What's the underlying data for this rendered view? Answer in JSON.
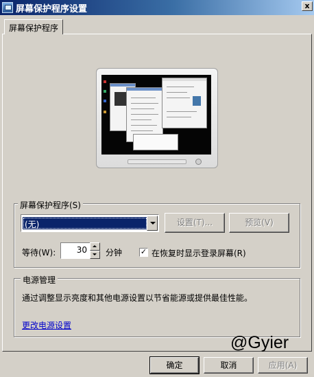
{
  "window": {
    "title": "屏幕保护程序设置",
    "close_glyph": "x"
  },
  "tabs": [
    {
      "label": "屏幕保护程序",
      "selected": true
    }
  ],
  "screensaver": {
    "group_label": "屏幕保护程序(S)",
    "selected_value": "(无)",
    "settings_label": "设置(T)...",
    "preview_label": "预览(V)",
    "wait_label": "等待(W):",
    "wait_value": "30",
    "wait_unit": "分钟",
    "resume_checkbox_label": "在恢复时显示登录屏幕(R)",
    "resume_checked": true,
    "check_glyph": "✓"
  },
  "power": {
    "group_label": "电源管理",
    "description": "通过调整显示亮度和其他电源设置以节省能源或提供最佳性能。",
    "link": "更改电源设置"
  },
  "footer": {
    "ok_label": "确定",
    "cancel_label": "取消",
    "apply_label": "应用(A)"
  },
  "watermark": "@Gyier",
  "colors": {
    "selection": "#0a246a",
    "window_bg": "#d4d0c8",
    "link": "#0000cc"
  }
}
